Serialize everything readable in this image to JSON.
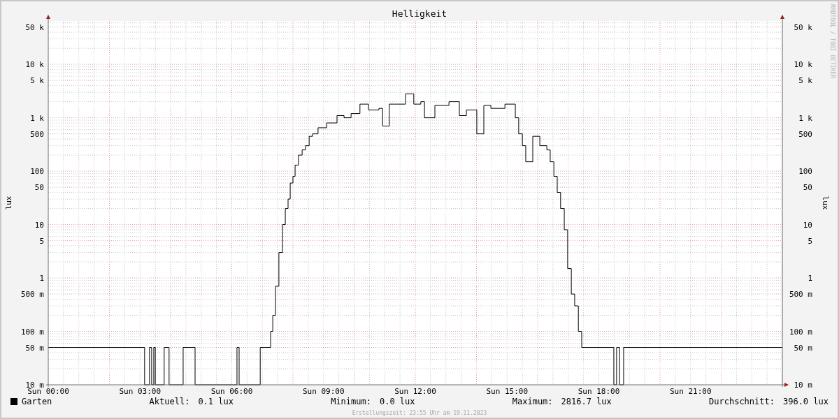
{
  "credit": "RRDTOOL / TOBI OETIKER",
  "chart": {
    "title": "Helligkeit",
    "ylabel": "lux",
    "x_tick_labels": [
      "Sun 00:00",
      "Sun 03:00",
      "Sun 06:00",
      "Sun 09:00",
      "Sun 12:00",
      "Sun 15:00",
      "Sun 18:00",
      "Sun 21:00"
    ],
    "y_tick_labels": [
      "50 k",
      "10 k",
      "5 k",
      "1 k",
      "500",
      "100",
      "50",
      "10",
      "5",
      "1",
      "500 m",
      "100 m",
      "50 m",
      "10 m"
    ],
    "right_axis": {
      "ylabel": "lux",
      "tick_labels": [
        "50 k",
        "10 k",
        "5 k",
        "1 k",
        "500",
        "100",
        "50",
        "10",
        "5",
        "1",
        "500 m",
        "100 m",
        "50 m",
        "10 m"
      ]
    }
  },
  "legend": {
    "series": {
      "name": "Garten",
      "color": "#000000"
    },
    "stats": [
      {
        "label": "Aktuell:",
        "value": "0.1 lux"
      },
      {
        "label": "Minimum:",
        "value": "0.0 lux"
      },
      {
        "label": "Maximum:",
        "value": "2816.7 lux"
      },
      {
        "label": "Durchschnitt:",
        "value": "396.0 lux"
      }
    ]
  },
  "footer": "Erstellungszeit: 23:55 Uhr am 19.11.2023"
}
